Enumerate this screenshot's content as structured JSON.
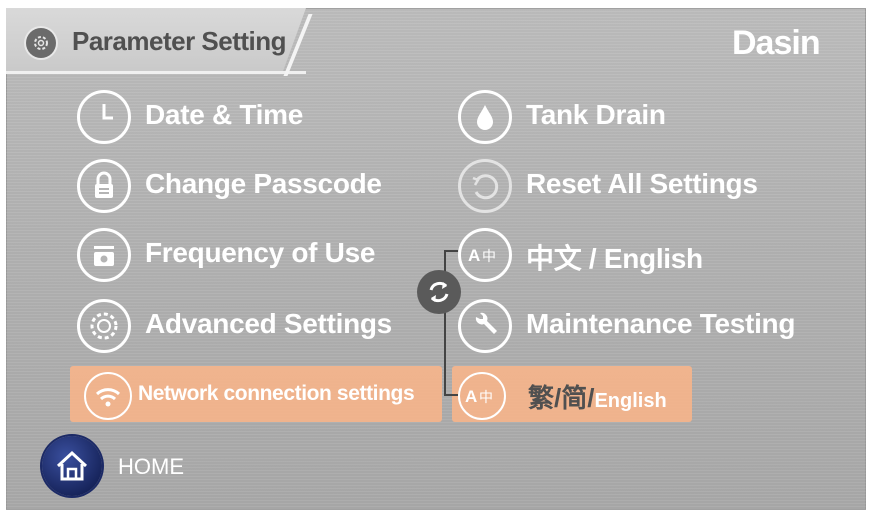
{
  "header": {
    "title": "Parameter Setting",
    "brand": "Dasin",
    "icon": "gear-icon"
  },
  "left_menu": [
    {
      "label": "Date & Time",
      "icon": "clock-icon"
    },
    {
      "label": "Change Passcode",
      "icon": "lock-icon"
    },
    {
      "label": "Frequency of Use",
      "icon": "frequency-icon"
    },
    {
      "label": "Advanced Settings",
      "icon": "gears-icon"
    },
    {
      "label": "Network connection settings",
      "icon": "wifi-icon",
      "highlighted": true
    }
  ],
  "right_menu": [
    {
      "label": "Tank Drain",
      "icon": "water-drop-icon"
    },
    {
      "label": "Reset All Settings",
      "icon": "reset-icon"
    },
    {
      "label": "中文 / English",
      "icon": "language-icon"
    },
    {
      "label": "Maintenance Testing",
      "icon": "wrench-icon"
    },
    {
      "label_main": "繁/简/",
      "label_tail": "English",
      "icon": "language-icon",
      "highlighted": true
    }
  ],
  "footer": {
    "home_label": "HOME"
  },
  "colors": {
    "highlight": "#f5b48b",
    "home_button": "#1f2f73",
    "panel": "#b4b4b4"
  }
}
